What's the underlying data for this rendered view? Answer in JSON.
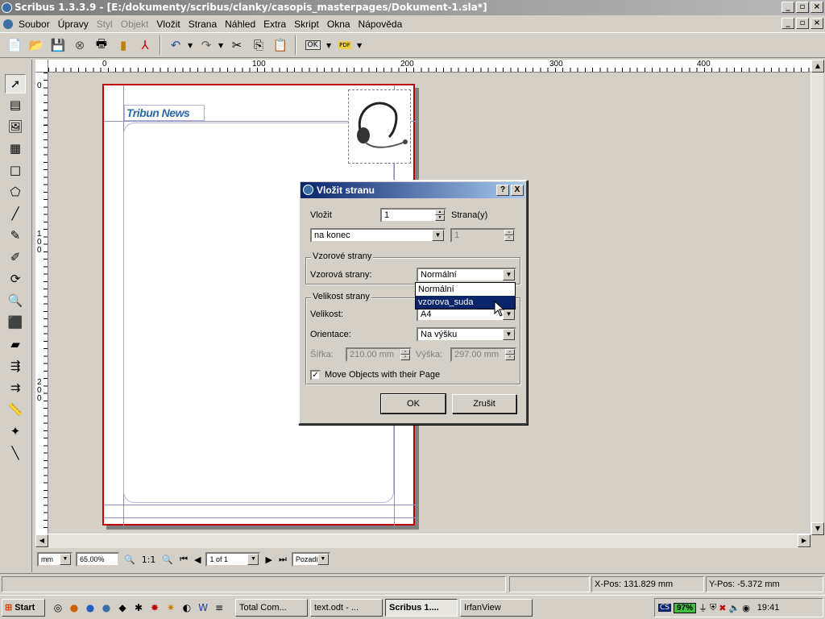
{
  "window": {
    "title": "Scribus 1.3.3.9 - [E:/dokumenty/scribus/clanky/casopis_masterpages/Dokument-1.sla*]"
  },
  "menu": {
    "items": [
      "Soubor",
      "Úpravy",
      "Styl",
      "Objekt",
      "Vložit",
      "Strana",
      "Náhled",
      "Extra",
      "Skript",
      "Okna",
      "Nápověda"
    ]
  },
  "toolbar": {
    "icons": [
      "new-icon",
      "open-icon",
      "save-icon",
      "close-icon",
      "print-icon",
      "preflight-icon",
      "pdf-export-icon",
      "undo-icon",
      "redo-icon",
      "cut-icon",
      "copy-icon",
      "paste-icon",
      "ok-icon",
      "pdf-icon"
    ],
    "ok_label": "OK",
    "pdf_label": "PDF"
  },
  "ruler": {
    "h_labels": [
      "0",
      "100",
      "200",
      "300",
      "400"
    ],
    "v_labels": [
      "0",
      "100",
      "200"
    ]
  },
  "document": {
    "logo_text": "Tribun News"
  },
  "view": {
    "unit": "mm",
    "zoom": "65.00%",
    "zoom_ratio": "1:1",
    "page": "1 of 1",
    "view_mode": "Pozadí"
  },
  "status": {
    "xpos_label": "X-Pos:",
    "xpos_value": "131.829 mm",
    "ypos_label": "Y-Pos:",
    "ypos_value": "-5.372 mm"
  },
  "dialog": {
    "title": "Vložit stranu",
    "help_btn": "?",
    "close_btn": "X",
    "insert_label": "Vložit",
    "insert_count": "1",
    "pages_label": "Strana(y)",
    "position_value": "na konec",
    "page_number": "1",
    "master_group": "Vzorové strany",
    "master_label": "Vzorová strany:",
    "master_value": "Normální",
    "master_options": [
      "Normální",
      "vzorova_suda"
    ],
    "master_selected_index": 1,
    "size_group": "Velikost strany",
    "size_label": "Velikost:",
    "size_value": "A4",
    "orientation_label": "Orientace:",
    "orientation_value": "Na výšku",
    "width_label": "Šířka:",
    "width_value": "210.00 mm",
    "height_label": "Výška:",
    "height_value": "297.00 mm",
    "move_objects_label": "Move Objects with their Page",
    "move_objects_checked": true,
    "ok_label": "OK",
    "cancel_label": "Zrušit"
  },
  "taskbar": {
    "start_label": "Start",
    "tasks": [
      "Total Com...",
      "text.odt - ...",
      "Scribus 1....",
      "IrfanView"
    ],
    "active_task_index": 2,
    "tray_lang": "CS",
    "battery": "97%",
    "clock": "19:41"
  }
}
